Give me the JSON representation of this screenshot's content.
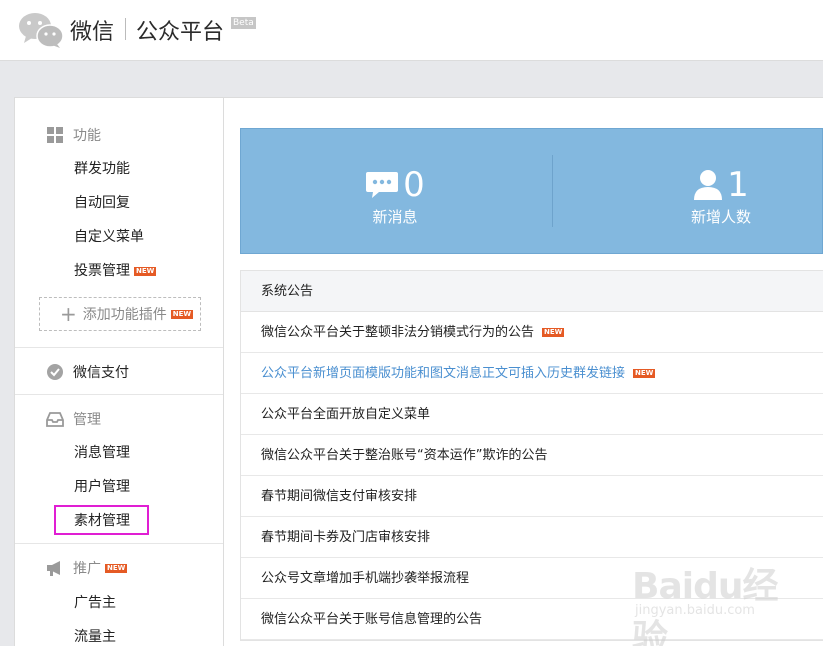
{
  "header": {
    "brand": "微信",
    "subtitle": "公众平台",
    "beta": "Beta"
  },
  "sidebar": {
    "features": {
      "label": "功能",
      "items": [
        "群发功能",
        "自动回复",
        "自定义菜单",
        "投票管理"
      ],
      "vote_badge": "NEW"
    },
    "add_plugin": {
      "label": "添加功能插件",
      "badge": "NEW"
    },
    "payment": {
      "label": "微信支付"
    },
    "manage": {
      "label": "管理",
      "items": [
        "消息管理",
        "用户管理",
        "素材管理"
      ]
    },
    "promote": {
      "label": "推广",
      "badge": "NEW",
      "items": [
        "广告主",
        "流量主"
      ]
    }
  },
  "stats": {
    "new_messages": {
      "value": "0",
      "label": "新消息"
    },
    "new_users": {
      "value": "1",
      "label": "新增人数"
    }
  },
  "notices": {
    "title": "系统公告",
    "badge": "NEW",
    "items": [
      "微信公众平台关于整顿非法分销模式行为的公告",
      "公众平台新增页面模版功能和图文消息正文可插入历史群发链接",
      "公众平台全面开放自定义菜单",
      "微信公众平台关于整治账号“资本运作”欺诈的公告",
      "春节期间微信支付审核安排",
      "春节期间卡券及门店审核安排",
      "公众号文章增加手机端抄袭举报流程",
      "微信公众平台关于账号信息管理的公告"
    ]
  },
  "watermark": {
    "main": "Baidu经验",
    "sub": "jingyan.baidu.com"
  },
  "colors": {
    "stats_bg": "#83b8df",
    "link": "#4a8fd0",
    "new_badge": "#e55a24",
    "highlight": "#e01ed3"
  }
}
